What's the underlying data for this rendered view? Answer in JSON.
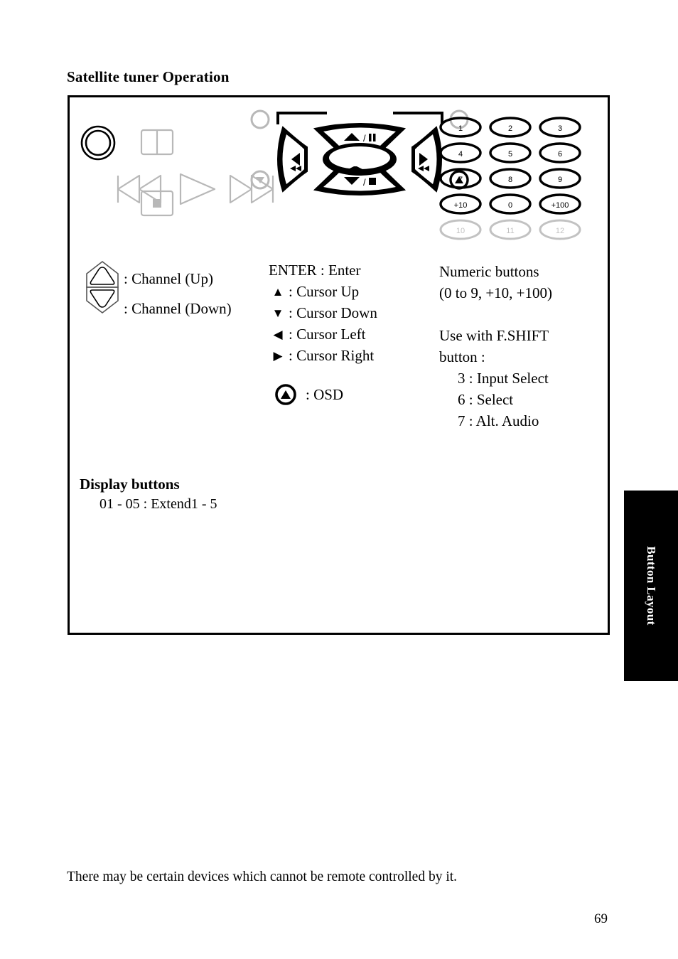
{
  "document": {
    "title": "Satellite tuner Operation",
    "page_number": "69",
    "footer_note": "There may be certain devices which cannot be remote controlled by it.",
    "side_tab_label": "Button Layout"
  },
  "remote": {
    "power_label": "I/⏻",
    "keypad": {
      "active_rows": [
        [
          "1",
          "2",
          "3"
        ],
        [
          "4",
          "5",
          "6"
        ],
        [
          "7",
          "8",
          "9"
        ],
        [
          "+10",
          "0",
          "+100"
        ]
      ],
      "disabled_row": [
        "10",
        "11",
        "12"
      ]
    },
    "navpad": {
      "up_label": "/❚❚",
      "down_label": "/■",
      "enter_name": "ENTER"
    }
  },
  "legend_left": {
    "channel_up": ": Channel (Up)",
    "channel_down": ": Channel (Down)"
  },
  "legend_middle": {
    "enter": "ENTER : Enter",
    "cursor_up_icon": "▲",
    "cursor_up": ": Cursor Up",
    "cursor_down_icon": "▼",
    "cursor_down": ": Cursor Down",
    "cursor_left_icon": "◀",
    "cursor_left": ": Cursor Left",
    "cursor_right_icon": "▶",
    "cursor_right": ": Cursor Right",
    "osd": ": OSD"
  },
  "legend_right": {
    "numeric_title": "Numeric buttons",
    "numeric_range": "(0 to 9, +10, +100)",
    "fshift_line1": "Use with F.SHIFT",
    "fshift_line2": " button :",
    "fshift_items": [
      "3 :  Input Select",
      "6 :  Select",
      "7 :  Alt. Audio"
    ]
  },
  "display_buttons": {
    "title": "Display buttons",
    "line": "01 - 05 : Extend1 - 5"
  },
  "colors": {
    "ink": "#000000",
    "disabled": "#b8b8b8",
    "tab_bg": "#000000",
    "tab_text": "#ffffff"
  }
}
